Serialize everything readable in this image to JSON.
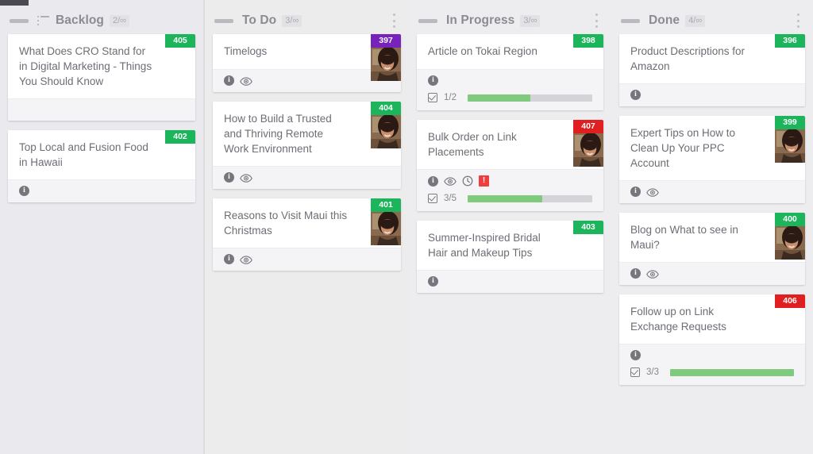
{
  "board": {
    "columns": [
      {
        "id": "backlog",
        "title": "Backlog",
        "count": "2/∞",
        "has_list_icon": true,
        "has_menu": false,
        "cards": [
          {
            "title": "What Does CRO Stand for in Digital Marketing - Things You Should Know",
            "badge": "405",
            "badge_color": "green",
            "avatar": false,
            "icons": [],
            "progress": null
          },
          {
            "title": "Top Local and Fusion Food in Hawaii",
            "badge": "402",
            "badge_color": "green",
            "avatar": false,
            "icons": [
              "info-icon"
            ],
            "progress": null
          }
        ]
      },
      {
        "id": "todo",
        "title": "To Do",
        "count": "3/∞",
        "has_list_icon": false,
        "has_menu": true,
        "cards": [
          {
            "title": "Timelogs",
            "badge": "397",
            "badge_color": "purple",
            "avatar": true,
            "icons": [
              "info-icon",
              "eye-icon"
            ],
            "progress": null
          },
          {
            "title": "How to Build a Trusted and Thriving Remote Work Environment",
            "badge": "404",
            "badge_color": "green",
            "avatar": true,
            "icons": [
              "info-icon",
              "eye-icon"
            ],
            "progress": null
          },
          {
            "title": "Reasons to Visit Maui this Christmas",
            "badge": "401",
            "badge_color": "green",
            "avatar": true,
            "icons": [
              "info-icon",
              "eye-icon"
            ],
            "progress": null
          }
        ]
      },
      {
        "id": "in-progress",
        "title": "In Progress",
        "count": "3/∞",
        "has_list_icon": false,
        "has_menu": true,
        "cards": [
          {
            "title": "Article on Tokai Region",
            "badge": "398",
            "badge_color": "green",
            "avatar": false,
            "icons": [
              "info-icon"
            ],
            "progress": {
              "label": "1/2",
              "percent": 50
            }
          },
          {
            "title": "Bulk Order on Link Placements",
            "badge": "407",
            "badge_color": "red",
            "avatar": true,
            "icons": [
              "info-icon",
              "eye-icon",
              "clock-icon",
              "alert-icon"
            ],
            "progress": {
              "label": "3/5",
              "percent": 60
            }
          },
          {
            "title": "Summer-Inspired Bridal Hair and Makeup Tips",
            "badge": "403",
            "badge_color": "green",
            "avatar": false,
            "icons": [
              "info-icon"
            ],
            "progress": null
          }
        ]
      },
      {
        "id": "done",
        "title": "Done",
        "count": "4/∞",
        "has_list_icon": false,
        "has_menu": true,
        "cards": [
          {
            "title": "Product Descriptions for Amazon",
            "badge": "396",
            "badge_color": "green",
            "avatar": false,
            "icons": [
              "info-icon"
            ],
            "progress": null
          },
          {
            "title": "Expert Tips on How to Clean Up Your PPC Account",
            "badge": "399",
            "badge_color": "green",
            "avatar": true,
            "icons": [
              "info-icon",
              "eye-icon"
            ],
            "progress": null
          },
          {
            "title": "Blog on What to see in Maui?",
            "badge": "400",
            "badge_color": "green",
            "avatar": true,
            "icons": [
              "info-icon",
              "eye-icon"
            ],
            "progress": null
          },
          {
            "title": "Follow up on Link Exchange Requests",
            "badge": "406",
            "badge_color": "red",
            "avatar": false,
            "icons": [
              "info-icon"
            ],
            "progress": {
              "label": "3/3",
              "percent": 100
            }
          }
        ]
      }
    ]
  },
  "colors": {
    "badge_green": "#1cb55c",
    "badge_purple": "#7722bb",
    "badge_red": "#e02020",
    "progress_fill": "#7fca7f",
    "progress_track": "#d3d3d8",
    "column_bg": "#ebebef",
    "card_bg": "#ffffff"
  },
  "icon_glyphs": {
    "info-icon": "i"
  }
}
